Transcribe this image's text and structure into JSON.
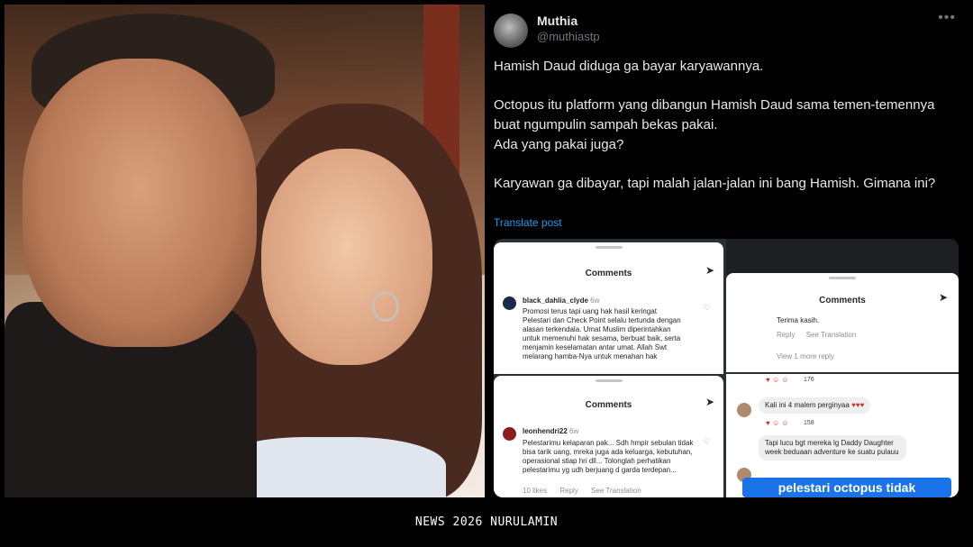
{
  "tweet": {
    "display_name": "Muthia",
    "handle": "@muthiastp",
    "more_icon": "more-options-icon",
    "paragraphs": [
      "Hamish Daud diduga ga bayar karyawannya.",
      "Octopus itu platform yang dibangun Hamish Daud sama temen-temennya buat ngumpulin sampah bekas pakai.\nAda yang pakai juga?",
      "Karyawan ga dibayar, tapi malah jalan-jalan ini bang Hamish. Gimana ini?"
    ],
    "translate_label": "Translate post"
  },
  "shots": {
    "card1": {
      "title": "Comments",
      "user": "black_dahlia_clyde",
      "time": "6w",
      "text": "Promosi terus tapi uang hak hasil keringat Pelestari dan Check Point selalu tertunda dengan alasan terkendala. Umat Muslim diperintahkan untuk memenuhi hak sesama, berbuat baik, serta menjamin keselamatan antar umat. Allah Swt melarang hamba-Nya untuk menahan hak"
    },
    "card2": {
      "title": "Comments",
      "text": "Terima kasih.",
      "reply": "Reply",
      "see_translation": "See Translation",
      "view_more": "View 1 more reply"
    },
    "card3": {
      "title": "Comments",
      "user": "leonhendri22",
      "time": "6w",
      "text": "Pelestarimu kelaparan pak... Sdh hmpir sebulan tidak bisa tarik uang, mreka juga ada keluarga, kebutuhan, operasional stiap hri dll... Tolonglah perhatikan pelestarimu yg udh berjuang d garda terdepan...",
      "likes": "10 likes",
      "reply": "Reply",
      "see_translation": "See Translation"
    },
    "chat": {
      "reaction_count_1": "176",
      "message_1": "Kali ini 4 malem perginyaa",
      "reaction_count_2": "158",
      "message_2": "Tapi lucu bgt mereka lg Daddy Daughter week beduaan adventure ke suatu pulauu",
      "caption": "pelestari octopus tidak"
    }
  },
  "footer": {
    "credit": "NEWS 2026 NURULAMIN"
  },
  "colors": {
    "background": "#000000",
    "link": "#1d9bf0",
    "muted": "#71767b",
    "caption_bg": "#1a73e8"
  }
}
